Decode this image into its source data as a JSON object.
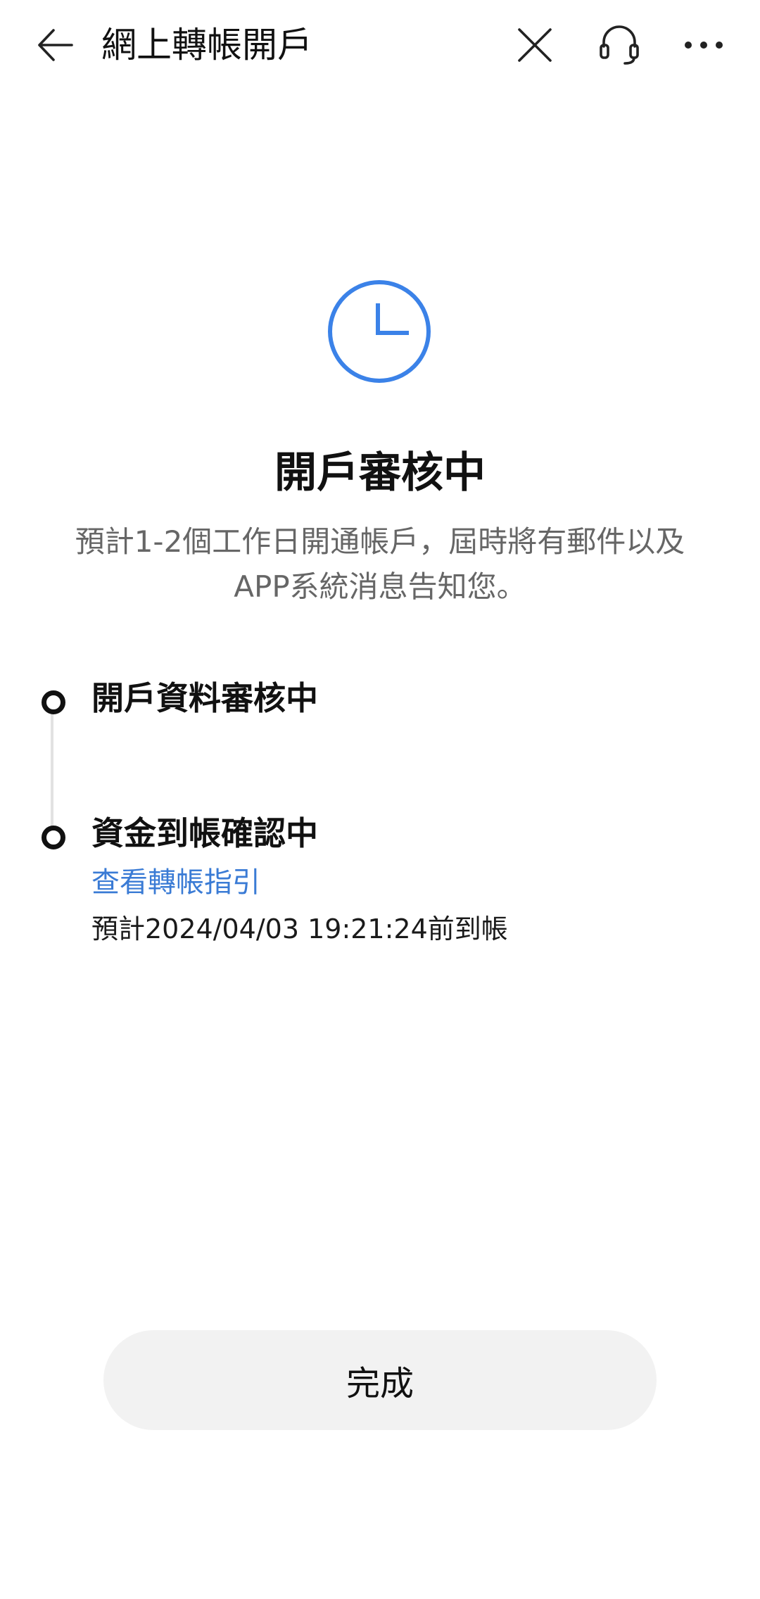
{
  "header": {
    "title": "網上轉帳開戶",
    "back_icon": "arrow-left-icon",
    "close_icon": "close-icon",
    "support_icon": "headset-icon",
    "more_icon": "more-horizontal-icon"
  },
  "status": {
    "icon": "clock-icon",
    "icon_color": "#3b82e8",
    "title": "開戶審核中",
    "description": "預計1-2個工作日開通帳戶，屆時將有郵件以及APP系統消息告知您。"
  },
  "timeline": {
    "steps": [
      {
        "title": "開戶資料審核中"
      },
      {
        "title": "資金到帳確認中",
        "link": "查看轉帳指引",
        "eta": "預計2024/04/03 19:21:24前到帳"
      }
    ]
  },
  "footer": {
    "done_label": "完成"
  },
  "colors": {
    "accent": "#3a7bd5",
    "button_bg": "#f2f2f2"
  }
}
